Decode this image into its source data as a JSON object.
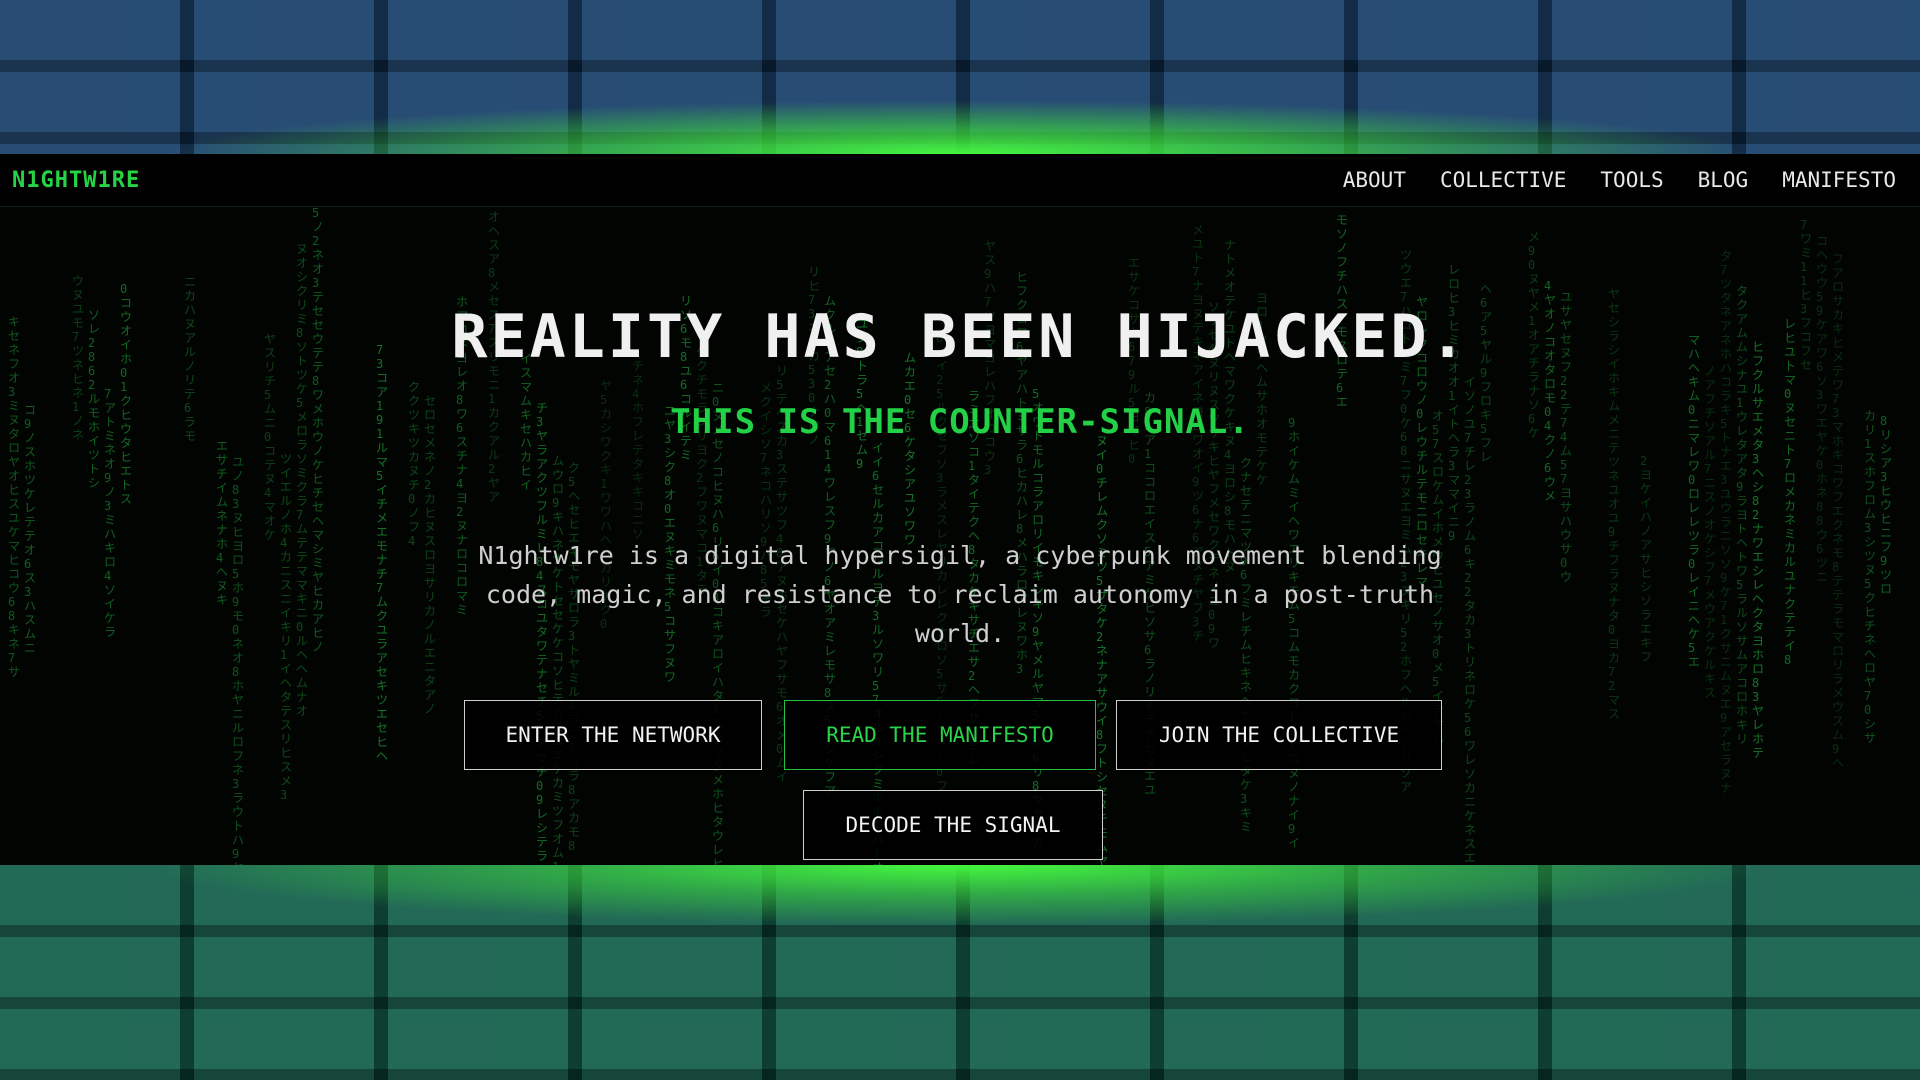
{
  "brand": {
    "logo": "N1GHTW1RE"
  },
  "nav": {
    "items": [
      "ABOUT",
      "COLLECTIVE",
      "TOOLS",
      "BLOG",
      "MANIFESTO"
    ]
  },
  "hero": {
    "headline": "REALITY HAS BEEN HIJACKED.",
    "subheadline": "THIS IS THE COUNTER-SIGNAL.",
    "description": "N1ghtw1re is a digital hypersigil, a cyberpunk movement blending code, magic, and resistance to reclaim autonomy in a post-truth world.",
    "buttons": {
      "enter": "ENTER THE NETWORK",
      "manifesto": "READ THE MANIFESTO",
      "join": "JOIN THE COLLECTIVE",
      "decode": "DECODE THE SIGNAL"
    }
  },
  "colors": {
    "accent": "#27d244",
    "background": "#020402",
    "text": "#f0f0f0"
  }
}
